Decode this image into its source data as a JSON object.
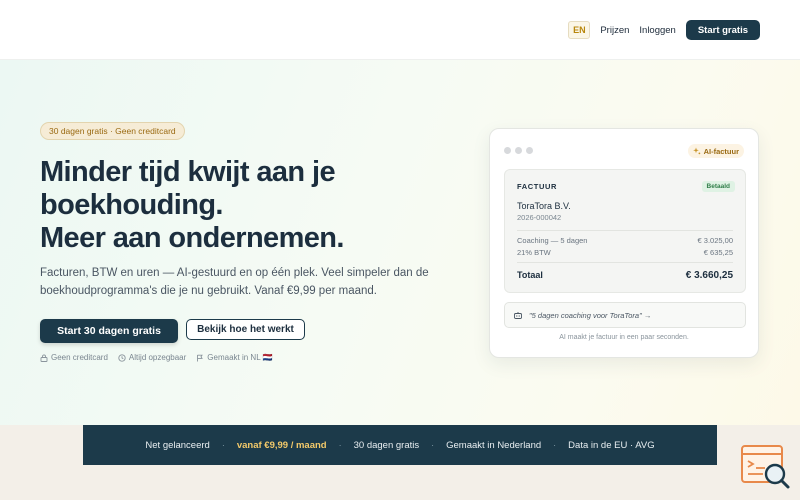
{
  "header": {
    "lang": "EN",
    "nav_links": [
      "Prijzen",
      "Inloggen"
    ],
    "cta": "Start gratis"
  },
  "hero": {
    "pill": "30 dagen gratis · Geen creditcard",
    "headline_lines": [
      "Minder tijd kwijt aan je",
      "boekhouding.",
      "Meer aan ondernemen."
    ],
    "subtext": "Facturen, BTW en uren — AI-gestuurd en op één plek. Veel simpeler dan de boekhoudprogramma's die je nu gebruikt. Vanaf €9,99 per maand.",
    "primary_cta": "Start 30 dagen gratis",
    "secondary_cta": "Bekijk hoe het werkt",
    "trust": [
      "Geen creditcard",
      "Altijd opzegbaar",
      "Gemaakt in NL 🇳🇱"
    ]
  },
  "card": {
    "ai_badge": "AI-factuur",
    "invoice_title": "FACTUUR",
    "status": "Betaald",
    "client": "ToraTora B.V.",
    "invoice_number": "2026-000042",
    "rows": [
      {
        "label": "Coaching — 5 dagen",
        "amount": "€ 3.025,00"
      },
      {
        "label": "21% BTW",
        "amount": "€ 635,25"
      }
    ],
    "total_label": "Totaal",
    "total_amount": "€ 3.660,25",
    "prompt": "\"5 dagen coaching voor ToraTora\" →",
    "caption": "AI maakt je factuur in een paar seconden."
  },
  "strip": {
    "items": [
      "Net gelanceerd",
      "vanaf €9,99 / maand",
      "30 dagen gratis",
      "Gemaakt in Nederland",
      "Data in de EU · AVG"
    ],
    "separator": "·"
  },
  "colors": {
    "brand": "#1c3a4a",
    "accent": "#f3c96a",
    "paid": "#2f7d48"
  }
}
